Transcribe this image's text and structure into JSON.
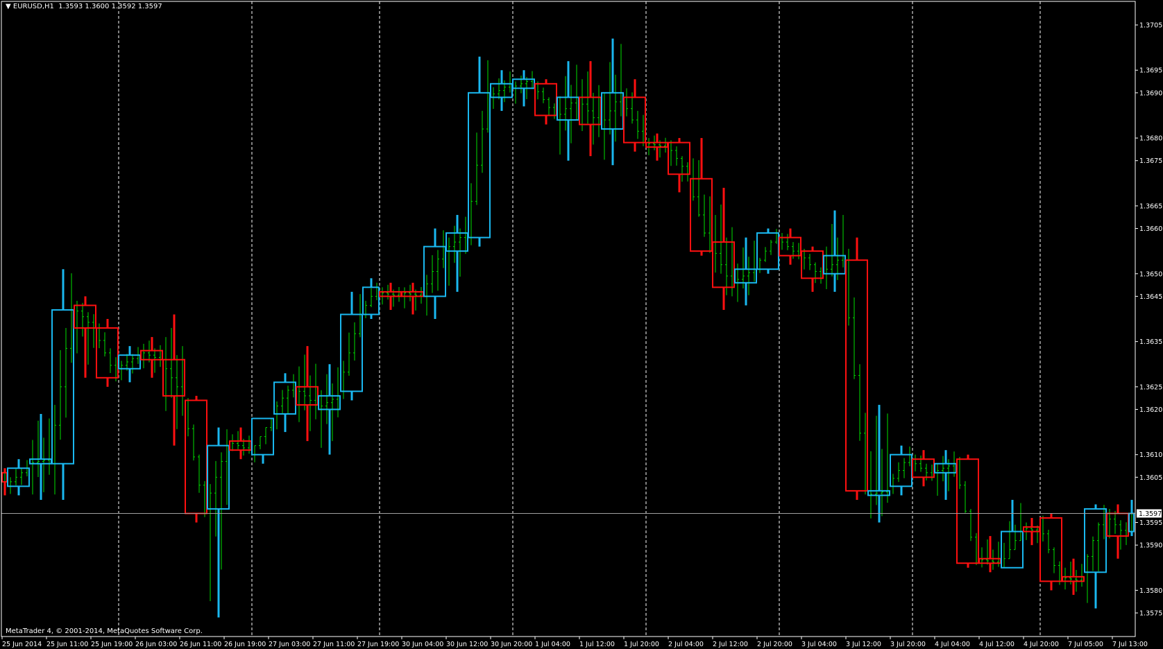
{
  "header": {
    "symbol": "EURUSD,H1",
    "ohlc": "1.3593 1.3600 1.3592 1.3597"
  },
  "copyright": "MetaTrader 4, © 2001-2014, MetaQuotes Software Corp.",
  "current_price": "1.3597",
  "colors": {
    "bull": "#1ab8f0",
    "bear": "#ff1010",
    "h1": "#00e000",
    "grid": "#ffffff",
    "price_line": "#a0a0a0"
  },
  "chart_data": {
    "type": "candlestick",
    "title": "EURUSD,H1",
    "ylim": [
      1.3571,
      1.371
    ],
    "y_ticks": [
      "1.3705",
      "1.3695",
      "1.3690",
      "1.3680",
      "1.3675",
      "1.3665",
      "1.3660",
      "1.3650",
      "1.3645",
      "1.3635",
      "1.3625",
      "1.3620",
      "1.3610",
      "1.3605",
      "1.3595",
      "1.3590",
      "1.3580",
      "1.3575"
    ],
    "x_labels": [
      "25 Jun 2014",
      "25 Jun 11:00",
      "25 Jun 19:00",
      "26 Jun 03:00",
      "26 Jun 11:00",
      "26 Jun 19:00",
      "27 Jun 03:00",
      "27 Jun 11:00",
      "27 Jun 19:00",
      "30 Jun 04:00",
      "30 Jun 12:00",
      "30 Jun 20:00",
      "1 Jul 04:00",
      "1 Jul 12:00",
      "1 Jul 20:00",
      "2 Jul 04:00",
      "2 Jul 12:00",
      "2 Jul 20:00",
      "3 Jul 04:00",
      "3 Jul 12:00",
      "3 Jul 20:00",
      "4 Jul 04:00",
      "4 Jul 12:00",
      "4 Jul 20:00",
      "7 Jul 05:00",
      "7 Jul 13:00"
    ],
    "candles_h4": [
      {
        "t": "25 Jun 00:00",
        "n": 1,
        "o": 1.3606,
        "h": 1.3607,
        "l": 1.3601,
        "c": 1.3604
      },
      {
        "t": "25 Jun 04:00",
        "n": 4,
        "o": 1.3603,
        "h": 1.3609,
        "l": 1.3601,
        "c": 1.3607
      },
      {
        "t": "25 Jun 08:00",
        "n": 4,
        "o": 1.3608,
        "h": 1.3619,
        "l": 1.36,
        "c": 1.3609
      },
      {
        "t": "25 Jun 12:00",
        "n": 4,
        "o": 1.3608,
        "h": 1.3651,
        "l": 1.36,
        "c": 1.3642
      },
      {
        "t": "25 Jun 16:00",
        "n": 4,
        "o": 1.3643,
        "h": 1.3645,
        "l": 1.3627,
        "c": 1.3638
      },
      {
        "t": "25 Jun 20:00",
        "n": 4,
        "o": 1.3638,
        "h": 1.364,
        "l": 1.3625,
        "c": 1.3627
      },
      {
        "t": "26 Jun 00:00",
        "n": 4,
        "o": 1.3629,
        "h": 1.3634,
        "l": 1.3626,
        "c": 1.3632
      },
      {
        "t": "26 Jun 04:00",
        "n": 4,
        "o": 1.3633,
        "h": 1.3636,
        "l": 1.3627,
        "c": 1.3631
      },
      {
        "t": "26 Jun 08:00",
        "n": 4,
        "o": 1.3631,
        "h": 1.3641,
        "l": 1.3612,
        "c": 1.3623
      },
      {
        "t": "26 Jun 12:00",
        "n": 4,
        "o": 1.3622,
        "h": 1.3623,
        "l": 1.3595,
        "c": 1.3597
      },
      {
        "t": "26 Jun 16:00",
        "n": 4,
        "o": 1.3598,
        "h": 1.3616,
        "l": 1.3574,
        "c": 1.3612
      },
      {
        "t": "26 Jun 20:00",
        "n": 4,
        "o": 1.3613,
        "h": 1.3616,
        "l": 1.3609,
        "c": 1.3611
      },
      {
        "t": "27 Jun 00:00",
        "n": 4,
        "o": 1.361,
        "h": 1.3618,
        "l": 1.3608,
        "c": 1.3618
      },
      {
        "t": "27 Jun 04:00",
        "n": 4,
        "o": 1.3619,
        "h": 1.3628,
        "l": 1.3615,
        "c": 1.3626
      },
      {
        "t": "27 Jun 08:00",
        "n": 4,
        "o": 1.3625,
        "h": 1.3634,
        "l": 1.3613,
        "c": 1.3621
      },
      {
        "t": "27 Jun 12:00",
        "n": 4,
        "o": 1.362,
        "h": 1.363,
        "l": 1.361,
        "c": 1.3623
      },
      {
        "t": "27 Jun 16:00",
        "n": 4,
        "o": 1.3624,
        "h": 1.3646,
        "l": 1.3622,
        "c": 1.3641
      },
      {
        "t": "27 Jun 20:00",
        "n": 3,
        "o": 1.3641,
        "h": 1.3649,
        "l": 1.364,
        "c": 1.3647
      },
      {
        "t": "30 Jun 00:00",
        "n": 4,
        "o": 1.3646,
        "h": 1.3648,
        "l": 1.3642,
        "c": 1.3645
      },
      {
        "t": "30 Jun 04:00",
        "n": 4,
        "o": 1.3646,
        "h": 1.3648,
        "l": 1.3641,
        "c": 1.3645
      },
      {
        "t": "30 Jun 08:00",
        "n": 4,
        "o": 1.3645,
        "h": 1.366,
        "l": 1.364,
        "c": 1.3656
      },
      {
        "t": "30 Jun 12:00",
        "n": 4,
        "o": 1.3655,
        "h": 1.3663,
        "l": 1.3646,
        "c": 1.3659
      },
      {
        "t": "30 Jun 16:00",
        "n": 4,
        "o": 1.3658,
        "h": 1.3698,
        "l": 1.3656,
        "c": 1.369
      },
      {
        "t": "30 Jun 20:00",
        "n": 4,
        "o": 1.3689,
        "h": 1.3695,
        "l": 1.3686,
        "c": 1.3692
      },
      {
        "t": "1 Jul 00:00",
        "n": 4,
        "o": 1.3691,
        "h": 1.3695,
        "l": 1.3687,
        "c": 1.3693
      },
      {
        "t": "1 Jul 04:00",
        "n": 4,
        "o": 1.3692,
        "h": 1.3693,
        "l": 1.3683,
        "c": 1.3685
      },
      {
        "t": "1 Jul 08:00",
        "n": 4,
        "o": 1.3684,
        "h": 1.3697,
        "l": 1.3675,
        "c": 1.3689
      },
      {
        "t": "1 Jul 12:00",
        "n": 4,
        "o": 1.3689,
        "h": 1.3697,
        "l": 1.3676,
        "c": 1.3683
      },
      {
        "t": "1 Jul 16:00",
        "n": 4,
        "o": 1.3682,
        "h": 1.3702,
        "l": 1.3674,
        "c": 1.369
      },
      {
        "t": "1 Jul 20:00",
        "n": 4,
        "o": 1.3689,
        "h": 1.3693,
        "l": 1.3677,
        "c": 1.3679
      },
      {
        "t": "2 Jul 00:00",
        "n": 4,
        "o": 1.3679,
        "h": 1.3681,
        "l": 1.3675,
        "c": 1.3678
      },
      {
        "t": "2 Jul 04:00",
        "n": 4,
        "o": 1.3679,
        "h": 1.368,
        "l": 1.3668,
        "c": 1.3672
      },
      {
        "t": "2 Jul 08:00",
        "n": 4,
        "o": 1.3671,
        "h": 1.368,
        "l": 1.3654,
        "c": 1.3655
      },
      {
        "t": "2 Jul 12:00",
        "n": 4,
        "o": 1.3657,
        "h": 1.3669,
        "l": 1.3642,
        "c": 1.3647
      },
      {
        "t": "2 Jul 16:00",
        "n": 4,
        "o": 1.3648,
        "h": 1.3658,
        "l": 1.3643,
        "c": 1.3651
      },
      {
        "t": "2 Jul 20:00",
        "n": 4,
        "o": 1.3651,
        "h": 1.366,
        "l": 1.365,
        "c": 1.3659
      },
      {
        "t": "3 Jul 00:00",
        "n": 4,
        "o": 1.3658,
        "h": 1.366,
        "l": 1.3652,
        "c": 1.3654
      },
      {
        "t": "3 Jul 04:00",
        "n": 4,
        "o": 1.3655,
        "h": 1.3656,
        "l": 1.3646,
        "c": 1.3649
      },
      {
        "t": "3 Jul 08:00",
        "n": 4,
        "o": 1.365,
        "h": 1.3664,
        "l": 1.3646,
        "c": 1.3654
      },
      {
        "t": "3 Jul 12:00",
        "n": 4,
        "o": 1.3653,
        "h": 1.3658,
        "l": 1.36,
        "c": 1.3602
      },
      {
        "t": "3 Jul 16:00",
        "n": 4,
        "o": 1.3601,
        "h": 1.3621,
        "l": 1.3595,
        "c": 1.3602
      },
      {
        "t": "3 Jul 20:00",
        "n": 4,
        "o": 1.3603,
        "h": 1.3612,
        "l": 1.3601,
        "c": 1.361
      },
      {
        "t": "4 Jul 00:00",
        "n": 4,
        "o": 1.3609,
        "h": 1.3611,
        "l": 1.3603,
        "c": 1.3605
      },
      {
        "t": "4 Jul 04:00",
        "n": 4,
        "o": 1.3606,
        "h": 1.3611,
        "l": 1.36,
        "c": 1.3608
      },
      {
        "t": "4 Jul 08:00",
        "n": 4,
        "o": 1.3609,
        "h": 1.361,
        "l": 1.3585,
        "c": 1.3586
      },
      {
        "t": "4 Jul 12:00",
        "n": 4,
        "o": 1.3587,
        "h": 1.3592,
        "l": 1.3584,
        "c": 1.3586
      },
      {
        "t": "4 Jul 16:00",
        "n": 4,
        "o": 1.3585,
        "h": 1.36,
        "l": 1.3585,
        "c": 1.3593
      },
      {
        "t": "4 Jul 20:00",
        "n": 3,
        "o": 1.3594,
        "h": 1.3596,
        "l": 1.359,
        "c": 1.3593
      },
      {
        "t": "7 Jul 00:00",
        "n": 4,
        "o": 1.3596,
        "h": 1.3597,
        "l": 1.358,
        "c": 1.3582
      },
      {
        "t": "7 Jul 04:00",
        "n": 4,
        "o": 1.3583,
        "h": 1.3587,
        "l": 1.3579,
        "c": 1.3582
      },
      {
        "t": "7 Jul 08:00",
        "n": 4,
        "o": 1.3584,
        "h": 1.3599,
        "l": 1.3576,
        "c": 1.3598
      },
      {
        "t": "7 Jul 12:00",
        "n": 4,
        "o": 1.3597,
        "h": 1.3599,
        "l": 1.3587,
        "c": 1.3592
      },
      {
        "t": "7 Jul 16:00",
        "n": 1,
        "o": 1.3593,
        "h": 1.36,
        "l": 1.3592,
        "c": 1.3597
      }
    ]
  }
}
